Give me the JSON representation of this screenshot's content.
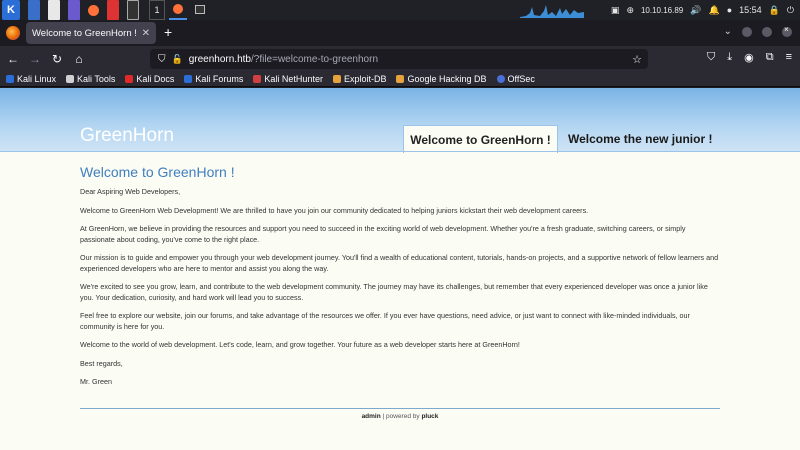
{
  "panel": {
    "workspace_number": "1",
    "network_ip": "10.10.16.89",
    "clock": "15:54"
  },
  "browser": {
    "tab_title": "Welcome to GreenHorn ! - Gr",
    "tab_close": "✕",
    "new_tab": "+",
    "url_host": "greenhorn.htb",
    "url_path": "/?file=welcome-to-greenhorn",
    "bookmarks": [
      {
        "label": "Kali Linux",
        "color": "#2b6fd6"
      },
      {
        "label": "Kali Tools",
        "color": "#d0d0d0"
      },
      {
        "label": "Kali Docs",
        "color": "#e02a2a"
      },
      {
        "label": "Kali Forums",
        "color": "#2b6fd6"
      },
      {
        "label": "Kali NetHunter",
        "color": "#d04040"
      },
      {
        "label": "Exploit-DB",
        "color": "#e6a23c"
      },
      {
        "label": "Google Hacking DB",
        "color": "#e6a23c"
      },
      {
        "label": "OffSec",
        "color": "#4a6fd6"
      }
    ]
  },
  "site": {
    "title": "GreenHorn",
    "tabs": [
      {
        "label": "Welcome to GreenHorn !"
      },
      {
        "label": "Welcome the new junior !"
      }
    ],
    "heading": "Welcome to GreenHorn !",
    "paragraphs": [
      "Dear Aspiring Web Developers,",
      "Welcome to GreenHorn Web Development! We are thrilled to have you join our community dedicated to helping juniors kickstart their web development careers.",
      "At GreenHorn, we believe in providing the resources and support you need to succeed in the exciting world of web development. Whether you're a fresh graduate, switching careers, or simply passionate about coding, you've come to the right place.",
      "Our mission is to guide and empower you through your web development journey. You'll find a wealth of educational content, tutorials, hands-on projects, and a supportive network of fellow learners and experienced developers who are here to mentor and assist you along the way.",
      "We're excited to see you grow, learn, and contribute to the web development community. The journey may have its challenges, but remember that every experienced developer was once a junior like you. Your dedication, curiosity, and hard work will lead you to success.",
      "Feel free to explore our website, join our forums, and take advantage of the resources we offer. If you ever have questions, need advice, or just want to connect with like-minded individuals, our community is here for you.",
      "Welcome to the world of web development. Let's code, learn, and grow together. Your future as a web developer starts here at GreenHorn!",
      "Best regards,",
      "Mr. Green"
    ],
    "footer": {
      "admin_link": "admin",
      "separator": " | powered by ",
      "pluck_link": "pluck"
    }
  }
}
